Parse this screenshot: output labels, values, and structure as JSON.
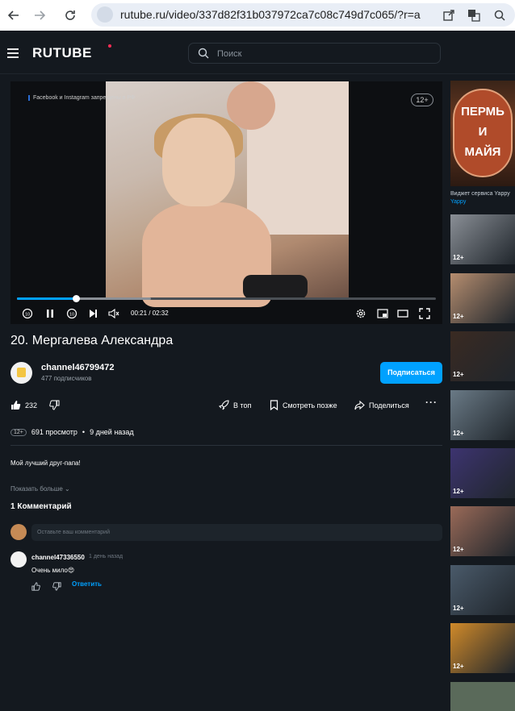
{
  "browser": {
    "url": "rutube.ru/video/337d82f31b037972ca7c08c749d7c065/?r=a"
  },
  "header": {
    "logo": "RUTUBE",
    "search_placeholder": "Поиск"
  },
  "player": {
    "overlay_notice": "Facebook и Instagram запрещены в РФ",
    "age_rating": "12+",
    "time": "00:21 / 02:32",
    "progress_percent": 14,
    "buffered_percent": 32
  },
  "video": {
    "title": "20. Мергалева Александра",
    "channel_name": "channel46799472",
    "subscribers": "477 подписчиков",
    "subscribe_label": "Подписаться",
    "likes": "232",
    "actions": {
      "top": "В топ",
      "watch_later": "Смотреть позже",
      "share": "Поделиться"
    },
    "age_rating": "12+",
    "views": "691 просмотр",
    "separator": "•",
    "published": "9 дней назад",
    "description": "Мой лучший друг-папа!",
    "show_more": "Показать больше"
  },
  "comments": {
    "title": "1 Комментарий",
    "input_placeholder": "Оставьте ваш комментарий",
    "items": [
      {
        "author": "channel47336550",
        "time": "1 день назад",
        "text": "Очень мило😍",
        "reply_label": "Ответить"
      }
    ]
  },
  "sidebar": {
    "promo": {
      "line1": "ПЕРМЬ",
      "line2": "И",
      "line3": "МАЙЯ",
      "caption": "Виджет сервиса Yappy",
      "caption_link": "Yappy"
    },
    "thumbs": [
      {
        "badge": "12+",
        "bg": "#8a8f96"
      },
      {
        "badge": "12+",
        "bg": "#b58d6f"
      },
      {
        "badge": "12+",
        "bg": "#3a2a22"
      },
      {
        "badge": "12+",
        "bg": "#6a7a86"
      },
      {
        "badge": "12+",
        "bg": "#3d3470"
      },
      {
        "badge": "12+",
        "bg": "#9a6a58"
      },
      {
        "badge": "12+",
        "bg": "#4a5a6a"
      },
      {
        "badge": "12+",
        "bg": "#d08a2a"
      }
    ]
  },
  "colors": {
    "background": "#14191f",
    "accent": "#00a1ff",
    "brand_dot": "#ff2d55"
  }
}
